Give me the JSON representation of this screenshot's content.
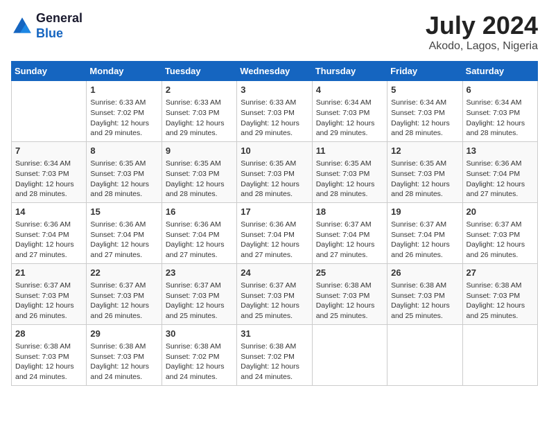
{
  "header": {
    "logo_line1": "General",
    "logo_line2": "Blue",
    "month_year": "July 2024",
    "location": "Akodo, Lagos, Nigeria"
  },
  "days_of_week": [
    "Sunday",
    "Monday",
    "Tuesday",
    "Wednesday",
    "Thursday",
    "Friday",
    "Saturday"
  ],
  "weeks": [
    [
      {
        "day": "",
        "info": ""
      },
      {
        "day": "1",
        "info": "Sunrise: 6:33 AM\nSunset: 7:02 PM\nDaylight: 12 hours\nand 29 minutes."
      },
      {
        "day": "2",
        "info": "Sunrise: 6:33 AM\nSunset: 7:03 PM\nDaylight: 12 hours\nand 29 minutes."
      },
      {
        "day": "3",
        "info": "Sunrise: 6:33 AM\nSunset: 7:03 PM\nDaylight: 12 hours\nand 29 minutes."
      },
      {
        "day": "4",
        "info": "Sunrise: 6:34 AM\nSunset: 7:03 PM\nDaylight: 12 hours\nand 29 minutes."
      },
      {
        "day": "5",
        "info": "Sunrise: 6:34 AM\nSunset: 7:03 PM\nDaylight: 12 hours\nand 28 minutes."
      },
      {
        "day": "6",
        "info": "Sunrise: 6:34 AM\nSunset: 7:03 PM\nDaylight: 12 hours\nand 28 minutes."
      }
    ],
    [
      {
        "day": "7",
        "info": "Sunrise: 6:34 AM\nSunset: 7:03 PM\nDaylight: 12 hours\nand 28 minutes."
      },
      {
        "day": "8",
        "info": "Sunrise: 6:35 AM\nSunset: 7:03 PM\nDaylight: 12 hours\nand 28 minutes."
      },
      {
        "day": "9",
        "info": "Sunrise: 6:35 AM\nSunset: 7:03 PM\nDaylight: 12 hours\nand 28 minutes."
      },
      {
        "day": "10",
        "info": "Sunrise: 6:35 AM\nSunset: 7:03 PM\nDaylight: 12 hours\nand 28 minutes."
      },
      {
        "day": "11",
        "info": "Sunrise: 6:35 AM\nSunset: 7:03 PM\nDaylight: 12 hours\nand 28 minutes."
      },
      {
        "day": "12",
        "info": "Sunrise: 6:35 AM\nSunset: 7:03 PM\nDaylight: 12 hours\nand 28 minutes."
      },
      {
        "day": "13",
        "info": "Sunrise: 6:36 AM\nSunset: 7:04 PM\nDaylight: 12 hours\nand 27 minutes."
      }
    ],
    [
      {
        "day": "14",
        "info": "Sunrise: 6:36 AM\nSunset: 7:04 PM\nDaylight: 12 hours\nand 27 minutes."
      },
      {
        "day": "15",
        "info": "Sunrise: 6:36 AM\nSunset: 7:04 PM\nDaylight: 12 hours\nand 27 minutes."
      },
      {
        "day": "16",
        "info": "Sunrise: 6:36 AM\nSunset: 7:04 PM\nDaylight: 12 hours\nand 27 minutes."
      },
      {
        "day": "17",
        "info": "Sunrise: 6:36 AM\nSunset: 7:04 PM\nDaylight: 12 hours\nand 27 minutes."
      },
      {
        "day": "18",
        "info": "Sunrise: 6:37 AM\nSunset: 7:04 PM\nDaylight: 12 hours\nand 27 minutes."
      },
      {
        "day": "19",
        "info": "Sunrise: 6:37 AM\nSunset: 7:04 PM\nDaylight: 12 hours\nand 26 minutes."
      },
      {
        "day": "20",
        "info": "Sunrise: 6:37 AM\nSunset: 7:03 PM\nDaylight: 12 hours\nand 26 minutes."
      }
    ],
    [
      {
        "day": "21",
        "info": "Sunrise: 6:37 AM\nSunset: 7:03 PM\nDaylight: 12 hours\nand 26 minutes."
      },
      {
        "day": "22",
        "info": "Sunrise: 6:37 AM\nSunset: 7:03 PM\nDaylight: 12 hours\nand 26 minutes."
      },
      {
        "day": "23",
        "info": "Sunrise: 6:37 AM\nSunset: 7:03 PM\nDaylight: 12 hours\nand 25 minutes."
      },
      {
        "day": "24",
        "info": "Sunrise: 6:37 AM\nSunset: 7:03 PM\nDaylight: 12 hours\nand 25 minutes."
      },
      {
        "day": "25",
        "info": "Sunrise: 6:38 AM\nSunset: 7:03 PM\nDaylight: 12 hours\nand 25 minutes."
      },
      {
        "day": "26",
        "info": "Sunrise: 6:38 AM\nSunset: 7:03 PM\nDaylight: 12 hours\nand 25 minutes."
      },
      {
        "day": "27",
        "info": "Sunrise: 6:38 AM\nSunset: 7:03 PM\nDaylight: 12 hours\nand 25 minutes."
      }
    ],
    [
      {
        "day": "28",
        "info": "Sunrise: 6:38 AM\nSunset: 7:03 PM\nDaylight: 12 hours\nand 24 minutes."
      },
      {
        "day": "29",
        "info": "Sunrise: 6:38 AM\nSunset: 7:03 PM\nDaylight: 12 hours\nand 24 minutes."
      },
      {
        "day": "30",
        "info": "Sunrise: 6:38 AM\nSunset: 7:02 PM\nDaylight: 12 hours\nand 24 minutes."
      },
      {
        "day": "31",
        "info": "Sunrise: 6:38 AM\nSunset: 7:02 PM\nDaylight: 12 hours\nand 24 minutes."
      },
      {
        "day": "",
        "info": ""
      },
      {
        "day": "",
        "info": ""
      },
      {
        "day": "",
        "info": ""
      }
    ]
  ]
}
